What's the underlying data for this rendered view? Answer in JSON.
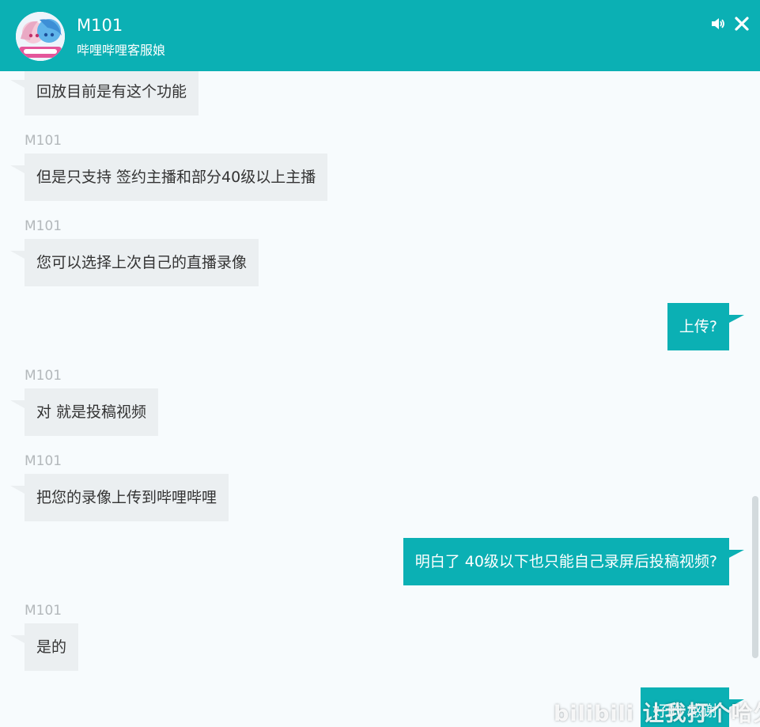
{
  "header": {
    "agent_name": "M101",
    "agent_subtitle": "哔哩哔哩客服娘",
    "icons": {
      "avatar": "anime-girls-avatar",
      "sound": "speaker-icon",
      "close": "close-icon"
    }
  },
  "colors": {
    "brand": "#0bb0b4",
    "incoming_bubble": "#ebeff1",
    "incoming_text": "#333333",
    "sender_label": "#b3b8bb",
    "background": "#f7fbfd"
  },
  "messages": [
    {
      "side": "in",
      "sender": "",
      "text": "回放目前是有这个功能"
    },
    {
      "side": "in",
      "sender": "M101",
      "text": "但是只支持 签约主播和部分40级以上主播"
    },
    {
      "side": "in",
      "sender": "M101",
      "text": "您可以选择上次自己的直播录像"
    },
    {
      "side": "out",
      "sender": "",
      "text": "上传?"
    },
    {
      "side": "in",
      "sender": "M101",
      "text": "对 就是投稿视频"
    },
    {
      "side": "in",
      "sender": "M101",
      "text": "把您的录像上传到哔哩哔哩"
    },
    {
      "side": "out",
      "sender": "",
      "text": "明白了 40级以下也只能自己录屏后投稿视频?"
    },
    {
      "side": "in",
      "sender": "M101",
      "text": "是的"
    },
    {
      "side": "out",
      "sender": "",
      "text": "好的 感谢"
    }
  ],
  "watermark": "bilibili 让我打个哈欠"
}
